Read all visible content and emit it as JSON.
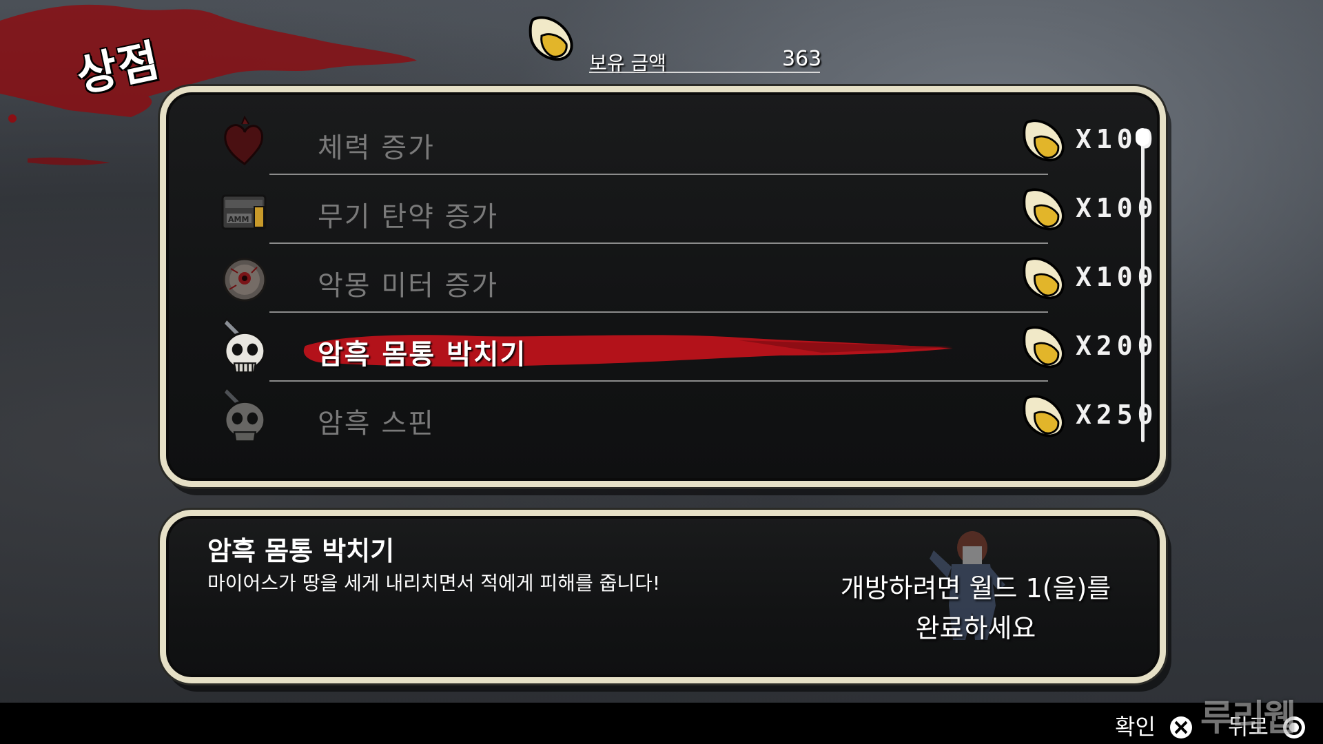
{
  "screen": {
    "title": "상점"
  },
  "balance": {
    "label": "보유 금액",
    "amount": "363",
    "currency_icon": "candy-corn-icon"
  },
  "shop": {
    "items": [
      {
        "name": "체력 증가",
        "price": "X100",
        "icon": "heart-icon",
        "selected": false
      },
      {
        "name": "무기 탄약 증가",
        "price": "X100",
        "icon": "ammo-box-icon",
        "selected": false
      },
      {
        "name": "악몽 미터 증가",
        "price": "X100",
        "icon": "eyeball-icon",
        "selected": false
      },
      {
        "name": "암흑 몸통 박치기",
        "price": "X200",
        "icon": "skull-knife-icon",
        "selected": true
      },
      {
        "name": "암흑 스핀",
        "price": "X250",
        "icon": "skull-knife-icon",
        "selected": false
      }
    ]
  },
  "description": {
    "title": "암흑 몸통 박치기",
    "text": "마이어스가 땅을 세게 내리치면서 적에게 피해를 줍니다!",
    "unlock_line1": "개방하려면 월드 1(을)를",
    "unlock_line2": "완료하세요"
  },
  "controls": {
    "confirm_label": "확인",
    "confirm_icon": "cross-button-icon",
    "back_label": "뒤로",
    "back_icon": "circle-button-icon"
  },
  "watermark": "루리웹",
  "colors": {
    "selected_stroke": "#b3121a",
    "panel_border": "#e6e0c6",
    "coin_gold": "#e2b52a"
  }
}
